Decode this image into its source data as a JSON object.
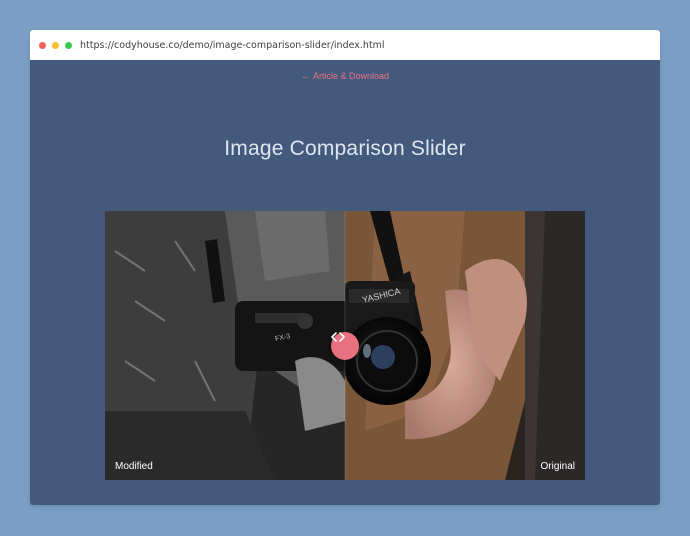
{
  "browser": {
    "url": "https://codyhouse.co/demo/image-comparison-slider/index.html",
    "traffic_lights": {
      "close": "#f25f58",
      "minimize": "#fbbe2e",
      "maximize": "#38c748"
    }
  },
  "page": {
    "back_link": "Article & Download",
    "title": "Image Comparison Slider"
  },
  "slider": {
    "label_modified": "Modified",
    "label_original": "Original",
    "position": 0.5,
    "handle_color": "#e8707f",
    "handle_icon": "chevron-left-right-icon"
  },
  "colors": {
    "background": "#7b9fc6",
    "page": "#445a7c",
    "accent": "#e8707f"
  }
}
